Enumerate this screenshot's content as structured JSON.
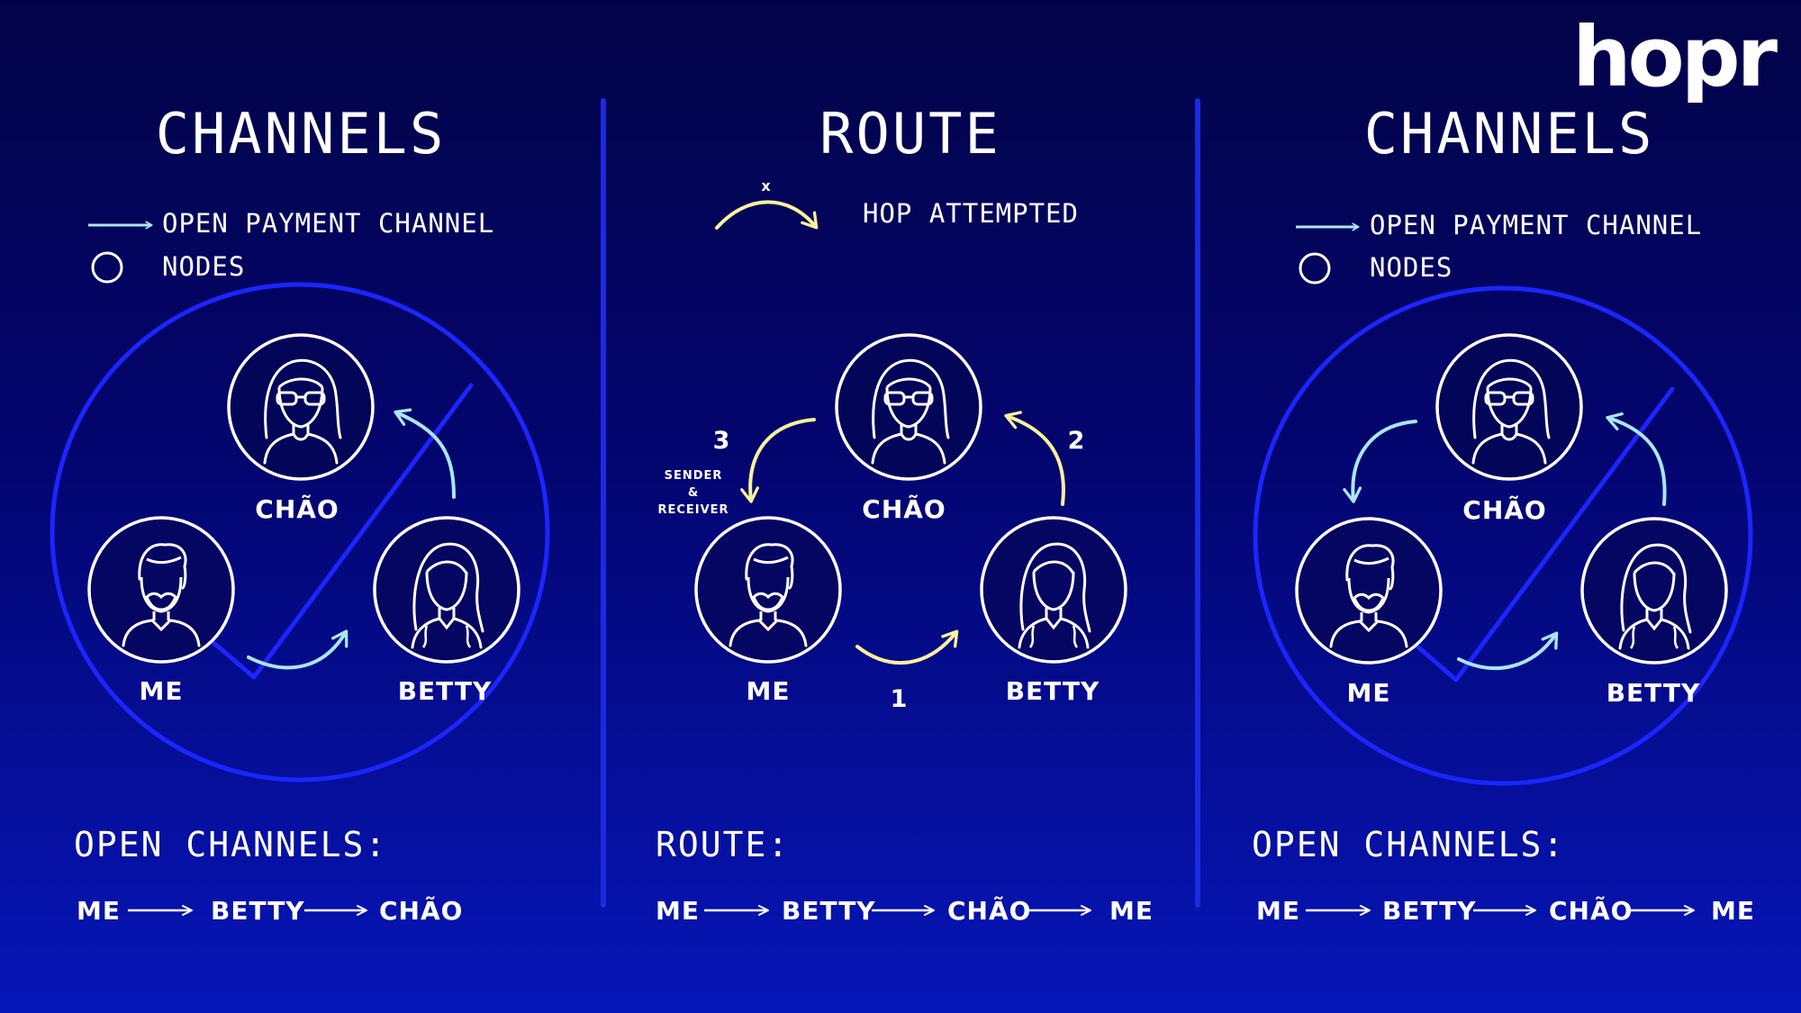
{
  "brand": {
    "logo": "hopr"
  },
  "colors": {
    "channel_arrow": "#a9e6f2",
    "route_arrow": "#fbf29b",
    "ring": "#1b26ff",
    "divider": "#1b2be0"
  },
  "panels": [
    {
      "title": "CHANNELS",
      "legend": [
        {
          "icon": "open-channel-arrow-icon",
          "label": "OPEN PAYMENT CHANNEL"
        },
        {
          "icon": "node-circle-icon",
          "label": "NODES"
        }
      ],
      "nodes": {
        "top": "CHÃO",
        "left": "ME",
        "right": "BETTY"
      },
      "footer": {
        "heading": "OPEN CHANNELS:",
        "sequence": [
          "ME",
          "BETTY",
          "CHÃO"
        ]
      }
    },
    {
      "title": "ROUTE",
      "legend": [
        {
          "icon": "hop-attempted-arrow-icon",
          "label": "HOP ATTEMPTED",
          "marker": "x"
        }
      ],
      "nodes": {
        "top": "CHÃO",
        "left": "ME",
        "right": "BETTY"
      },
      "hops": [
        "1",
        "2",
        "3"
      ],
      "note": [
        "SENDER",
        "&",
        "RECEIVER"
      ],
      "footer": {
        "heading": "ROUTE:",
        "sequence": [
          "ME",
          "BETTY",
          "CHÃO",
          "ME"
        ]
      }
    },
    {
      "title": "CHANNELS",
      "legend": [
        {
          "icon": "open-channel-arrow-icon",
          "label": "OPEN PAYMENT CHANNEL"
        },
        {
          "icon": "node-circle-icon",
          "label": "NODES"
        }
      ],
      "nodes": {
        "top": "CHÃO",
        "left": "ME",
        "right": "BETTY"
      },
      "footer": {
        "heading": "OPEN CHANNELS:",
        "sequence": [
          "ME",
          "BETTY",
          "CHÃO",
          "ME"
        ]
      }
    }
  ]
}
